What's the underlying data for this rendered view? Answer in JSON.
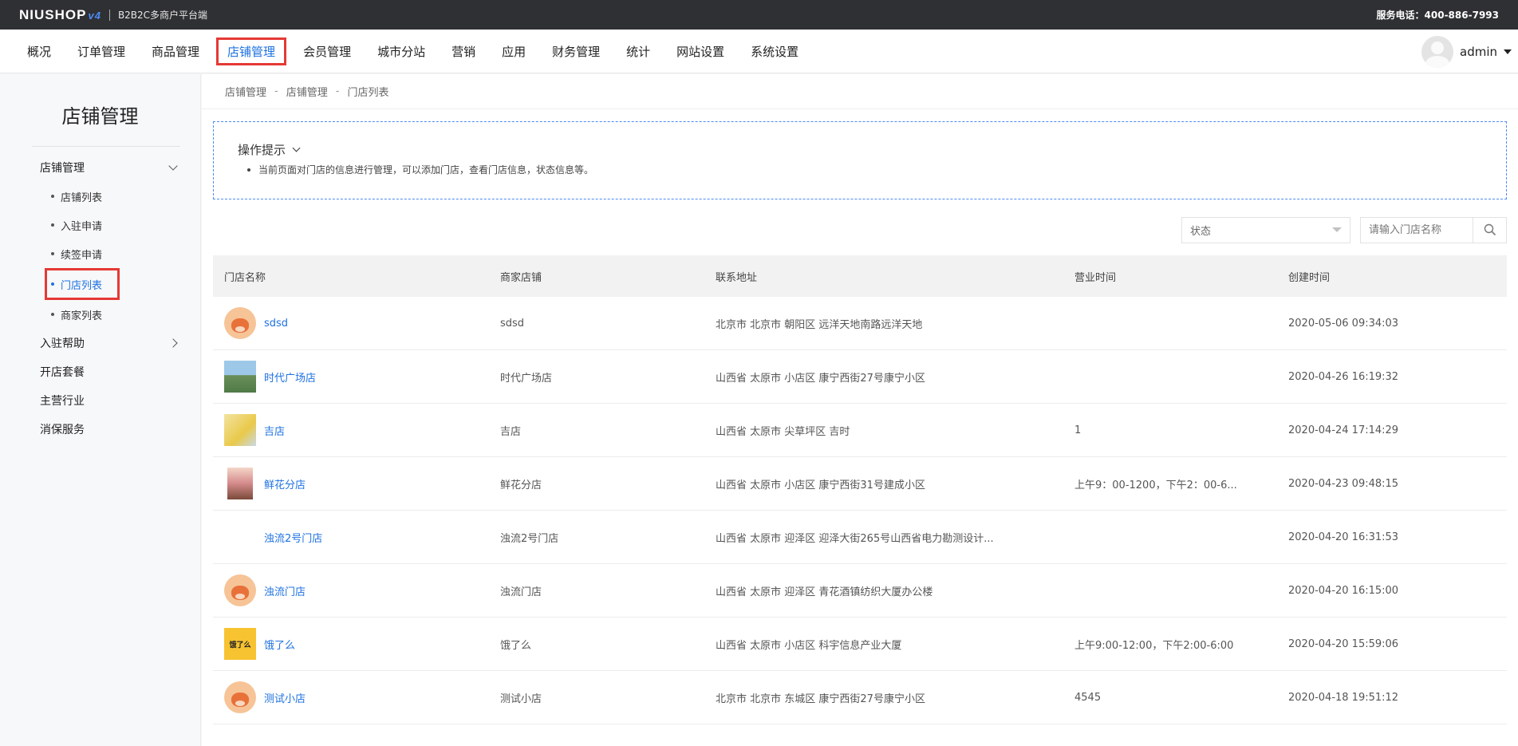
{
  "topbar": {
    "logo": "NIUSHOP",
    "logo_suffix": "v4",
    "subtitle": "B2B2C多商户平台端",
    "hotline": "服务电话：400-886-7993"
  },
  "nav": {
    "items": [
      "概况",
      "订单管理",
      "商品管理",
      "店铺管理",
      "会员管理",
      "城市分站",
      "营销",
      "应用",
      "财务管理",
      "统计",
      "网站设置",
      "系统设置"
    ],
    "user": "admin"
  },
  "sidebar": {
    "title": "店铺管理",
    "group1": "店铺管理",
    "sub": [
      "店铺列表",
      "入驻申请",
      "续签申请",
      "门店列表",
      "商家列表"
    ],
    "others": [
      "入驻帮助",
      "开店套餐",
      "主营行业",
      "消保服务"
    ]
  },
  "breadcrumb": [
    "店铺管理",
    "店铺管理",
    "门店列表"
  ],
  "tips": {
    "title": "操作提示",
    "item": "当前页面对门店的信息进行管理，可以添加门店，查看门店信息，状态信息等。"
  },
  "filters": {
    "status_label": "状态",
    "search_placeholder": "请输入门店名称"
  },
  "table": {
    "headers": [
      "门店名称",
      "商家店铺",
      "联系地址",
      "营业时间",
      "创建时间"
    ],
    "rows": [
      {
        "name": "sdsd",
        "merchant": "sdsd",
        "address": "北京市 北京市 朝阳区 远洋天地南路远洋天地",
        "hours": "",
        "created": "2020-05-06 09:34:03",
        "thumb": "cow"
      },
      {
        "name": "时代广场店",
        "merchant": "时代广场店",
        "address": "山西省 太原市 小店区 康宁西街27号康宁小区",
        "hours": "",
        "created": "2020-04-26 16:19:32",
        "thumb": "photo-sea"
      },
      {
        "name": "吉店",
        "merchant": "吉店",
        "address": "山西省 太原市 尖草坪区 吉时",
        "hours": "1",
        "created": "2020-04-24 17:14:29",
        "thumb": "photo-shop"
      },
      {
        "name": "鲜花分店",
        "merchant": "鲜花分店",
        "address": "山西省 太原市 小店区 康宁西街31号建成小区",
        "hours": "上午9：00-1200，下午2：00-6...",
        "created": "2020-04-23 09:48:15",
        "thumb": "photo-girl"
      },
      {
        "name": "浊流2号门店",
        "merchant": "浊流2号门店",
        "address": "山西省 太原市 迎泽区 迎泽大街265号山西省电力勘测设计...",
        "hours": "",
        "created": "2020-04-20 16:31:53",
        "thumb": "empty"
      },
      {
        "name": "浊流门店",
        "merchant": "浊流门店",
        "address": "山西省 太原市 迎泽区 青花酒镇纺织大厦办公楼",
        "hours": "",
        "created": "2020-04-20 16:15:00",
        "thumb": "cow"
      },
      {
        "name": "饿了么",
        "merchant": "饿了么",
        "address": "山西省 太原市 小店区 科宇信息产业大厦",
        "hours": "上午9:00-12:00，下午2:00-6:00",
        "created": "2020-04-20 15:59:06",
        "thumb": "ele"
      },
      {
        "name": "测试小店",
        "merchant": "测试小店",
        "address": "北京市 北京市 东城区 康宁西街27号康宁小区",
        "hours": "4545",
        "created": "2020-04-18 19:51:12",
        "thumb": "cow"
      }
    ]
  },
  "thumb_badge": "饿了么"
}
